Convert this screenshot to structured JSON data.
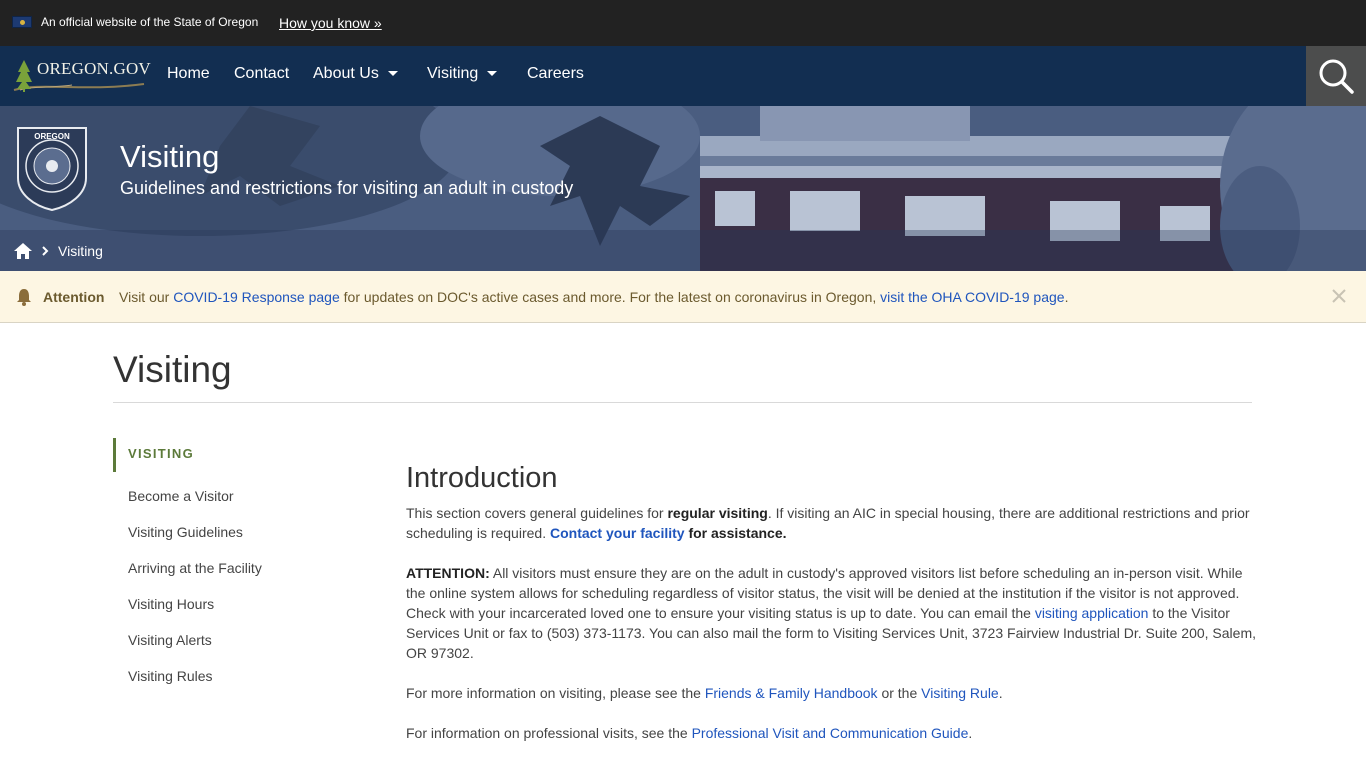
{
  "official_banner": {
    "text": "An official website of the State of Oregon",
    "link": "How you know »"
  },
  "navbar": {
    "logo_text": "OREGON.GOV",
    "items": [
      {
        "label": "Home"
      },
      {
        "label": "Contact"
      },
      {
        "label": "About Us"
      },
      {
        "label": "Visiting"
      },
      {
        "label": "Careers"
      }
    ]
  },
  "hero": {
    "title": "Visiting",
    "subtitle": "Guidelines and restrictions for visiting an adult in custody",
    "breadcrumb_current": "Visiting"
  },
  "alert": {
    "label": "Attention",
    "text_1": "Visit our ",
    "link_1": "COVID-19 Response page",
    "text_2": " for updates on DOC's active cases and more. For the latest on coronavirus in Oregon, ",
    "link_2": "visit the OHA COVID-19 page",
    "text_3": "."
  },
  "page_title": "Visiting",
  "sidebar": {
    "heading": "VISITING",
    "items": [
      {
        "label": "Become a Visitor"
      },
      {
        "label": "Visiting Guidelines"
      },
      {
        "label": "Arriving at the Facility"
      },
      {
        "label": "Visiting Hours"
      },
      {
        "label": "Visiting Alerts"
      },
      {
        "label": "Visiting Rules"
      }
    ]
  },
  "content": {
    "heading": "Introduction",
    "p1": {
      "t1": "This section covers general guidelines for ",
      "b1": "regular visiting",
      "t2": ". If visiting an AIC in special housing, there are additional restrictions and prior scheduling is required. ",
      "link": "Contact your facility",
      "b2": " for assistance."
    },
    "p2": {
      "b1": "ATTENTION:",
      "t1": " All visitors must ensure they are on the adult in custody's approved visitors list before scheduling an in-person visit. While the online system allows for scheduling regardless of visitor status, the visit will be denied at the institution if the visitor is not approved. Check with your incarcerated loved one to ensure your visiting status is up to date. You can email the ",
      "link": "visiting application",
      "t2": " to the Visitor Services Unit or fax to (503) 373-1173. You can also mail the form to Visiting Services Unit, 3723 Fairview Industrial Dr. Suite 200, Salem, OR 97302."
    },
    "p3": {
      "t1": "For more information on visiting, please see the ",
      "link1": "Friends & Family Handbook",
      "t2": " or the ",
      "link2": "Visiting Rule",
      "t3": "."
    },
    "p4": {
      "t1": "For information on professional visits, see the ",
      "link": "Professional Visit and Communication Guide",
      "t2": "."
    }
  }
}
